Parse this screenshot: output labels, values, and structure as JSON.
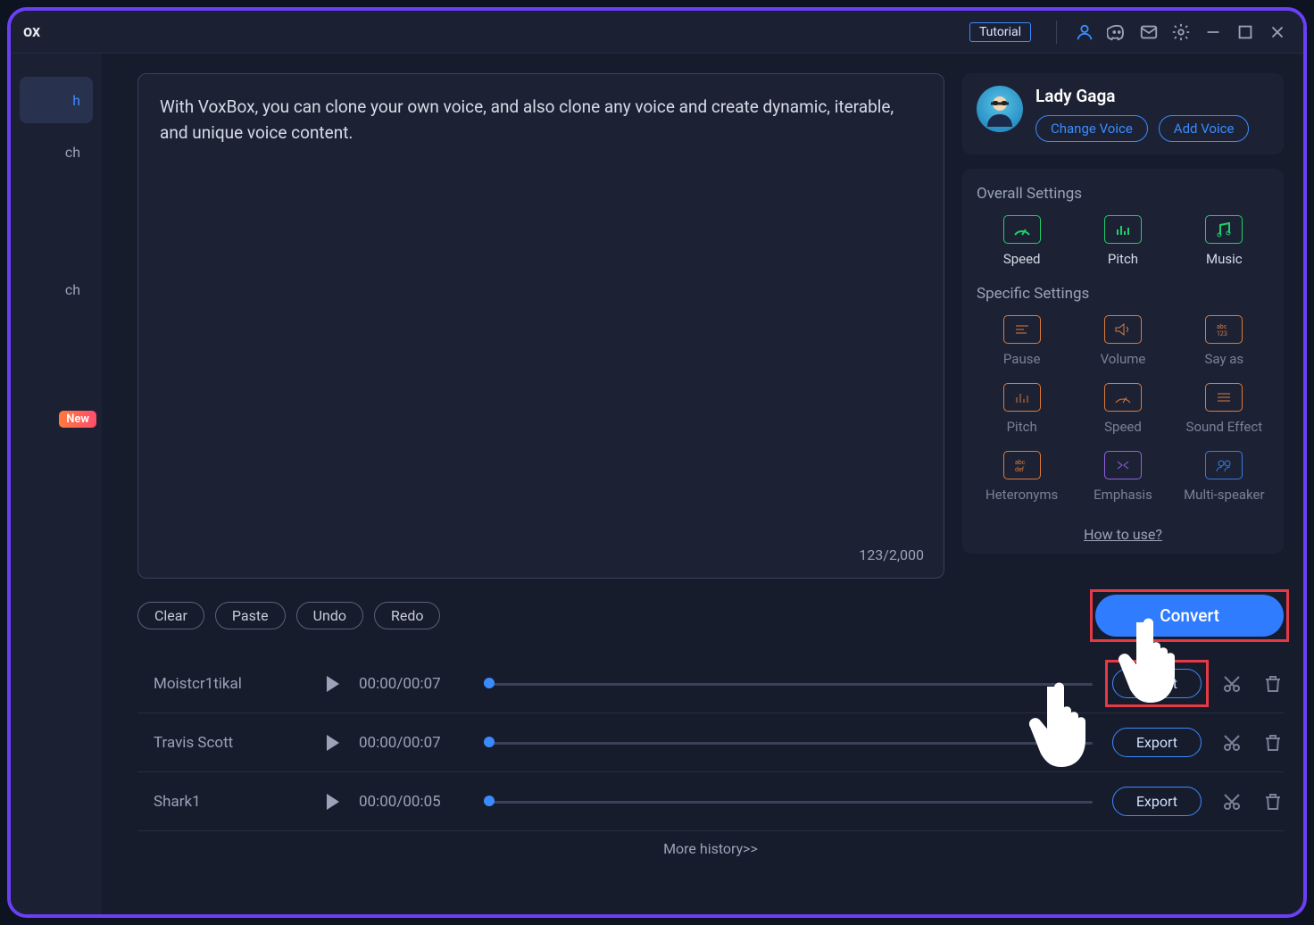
{
  "titlebar": {
    "app_name": "ox",
    "tutorial_label": "Tutorial"
  },
  "sidebar": {
    "items": [
      {
        "label": "h"
      },
      {
        "label": "ch"
      },
      {
        "label": "ch"
      }
    ],
    "new_badge": "New"
  },
  "editor": {
    "text": "With VoxBox, you can clone your own voice, and also clone any voice and create dynamic, iterable, and unique voice content.",
    "char_count": "123/2,000"
  },
  "voice": {
    "name": "Lady Gaga",
    "change_label": "Change Voice",
    "add_label": "Add Voice"
  },
  "settings": {
    "overall_title": "Overall Settings",
    "overall": [
      {
        "label": "Speed"
      },
      {
        "label": "Pitch"
      },
      {
        "label": "Music"
      }
    ],
    "specific_title": "Specific Settings",
    "specific": [
      {
        "label": "Pause"
      },
      {
        "label": "Volume"
      },
      {
        "label": "Say as"
      },
      {
        "label": "Pitch"
      },
      {
        "label": "Speed"
      },
      {
        "label": "Sound Effect"
      },
      {
        "label": "Heteronyms"
      },
      {
        "label": "Emphasis"
      },
      {
        "label": "Multi-speaker"
      }
    ],
    "howto": "How to use?"
  },
  "toolbar": {
    "clear": "Clear",
    "paste": "Paste",
    "undo": "Undo",
    "redo": "Redo",
    "convert": "Convert"
  },
  "tracks": [
    {
      "name": "Moistcr1tikal",
      "time": "00:00/00:07",
      "export": "Export"
    },
    {
      "name": "Travis Scott",
      "time": "00:00/00:07",
      "export": "Export"
    },
    {
      "name": "Shark1",
      "time": "00:00/00:05",
      "export": "Export"
    }
  ],
  "more_history": "More history>>"
}
